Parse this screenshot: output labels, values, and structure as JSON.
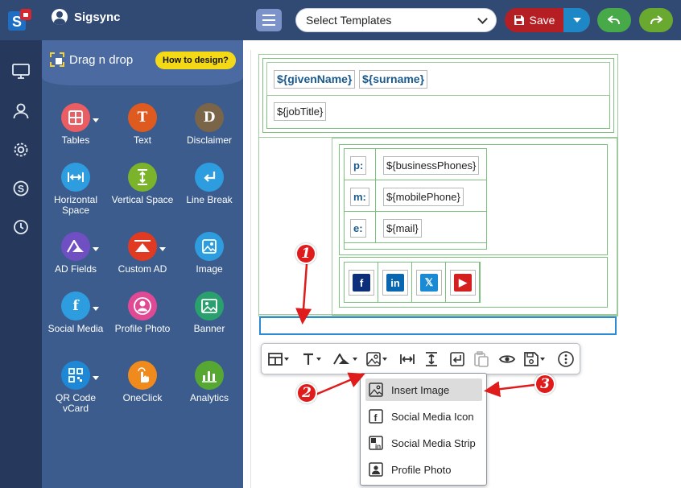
{
  "header": {
    "brand": "Sigsync",
    "template_select": "Select Templates",
    "save_label": "Save"
  },
  "panel": {
    "title": "Drag n drop",
    "how_to": "How to design?",
    "tools": [
      {
        "label": "Tables",
        "glyph": "",
        "color": "#ea5d63",
        "icon": "table-icon",
        "caret": true
      },
      {
        "label": "Text",
        "glyph": "T",
        "color": "#df5a1e",
        "icon": "text-icon",
        "caret": false
      },
      {
        "label": "Disclaimer",
        "glyph": "D",
        "color": "#7a6548",
        "icon": "disclaimer-icon",
        "caret": false
      },
      {
        "label": "Horizontal Space",
        "glyph": "",
        "color": "#2e9de0",
        "icon": "horizontal-space-icon",
        "caret": false
      },
      {
        "label": "Vertical Space",
        "glyph": "",
        "color": "#7bb42b",
        "icon": "vertical-space-icon",
        "caret": false
      },
      {
        "label": "Line Break",
        "glyph": "",
        "color": "#2e9de0",
        "icon": "line-break-icon",
        "caret": false
      },
      {
        "label": "AD Fields",
        "glyph": "",
        "color": "#6f4fc2",
        "icon": "ad-fields-icon",
        "caret": true
      },
      {
        "label": "Custom AD",
        "glyph": "",
        "color": "#e03a22",
        "icon": "custom-ad-icon",
        "caret": true
      },
      {
        "label": "Image",
        "glyph": "",
        "color": "#2e9de0",
        "icon": "image-icon",
        "caret": false
      },
      {
        "label": "Social Media",
        "glyph": "f",
        "color": "#2e9de0",
        "icon": "social-media-icon",
        "caret": true
      },
      {
        "label": "Profile Photo",
        "glyph": "",
        "color": "#e04a94",
        "icon": "profile-photo-icon",
        "caret": false
      },
      {
        "label": "Banner",
        "glyph": "",
        "color": "#2aa06e",
        "icon": "banner-icon",
        "caret": false
      },
      {
        "label": "QR Code vCard",
        "glyph": "",
        "color": "#1f88d6",
        "icon": "qr-code-icon",
        "caret": true
      },
      {
        "label": "OneClick",
        "glyph": "",
        "color": "#f08a1c",
        "icon": "oneclick-icon",
        "caret": false
      },
      {
        "label": "Analytics",
        "glyph": "",
        "color": "#57a833",
        "icon": "analytics-icon",
        "caret": false
      }
    ]
  },
  "canvas": {
    "given_name": "${givenName}",
    "surname": "${surname}",
    "job_title": "${jobTitle}",
    "contacts": [
      {
        "label": "p:",
        "value": "${businessPhones}"
      },
      {
        "label": "m:",
        "value": "${mobilePhone}"
      },
      {
        "label": "e:",
        "value": "${mail}"
      }
    ],
    "social": [
      {
        "name": "facebook-icon",
        "glyph": "f",
        "color": "#0d2f7a"
      },
      {
        "name": "linkedin-icon",
        "glyph": "in",
        "color": "#0b66b0"
      },
      {
        "name": "x-icon",
        "glyph": "𝕏",
        "color": "#1a8ad4"
      },
      {
        "name": "youtube-icon",
        "glyph": "▶",
        "color": "#d51f1f"
      }
    ]
  },
  "image_menu": {
    "items": [
      {
        "label": "Insert Image",
        "icon": "insert-image-icon"
      },
      {
        "label": "Social Media Icon",
        "icon": "social-media-icon"
      },
      {
        "label": "Social Media Strip",
        "icon": "social-media-strip-icon"
      },
      {
        "label": "Profile Photo",
        "icon": "profile-photo-icon"
      }
    ]
  },
  "annotations": [
    "1",
    "2",
    "3"
  ],
  "colors": {
    "header": "#314a74",
    "rail": "#26395c",
    "panel": "#3b5c8d",
    "save": "#b51f24",
    "annotation": "#e01b1b"
  }
}
